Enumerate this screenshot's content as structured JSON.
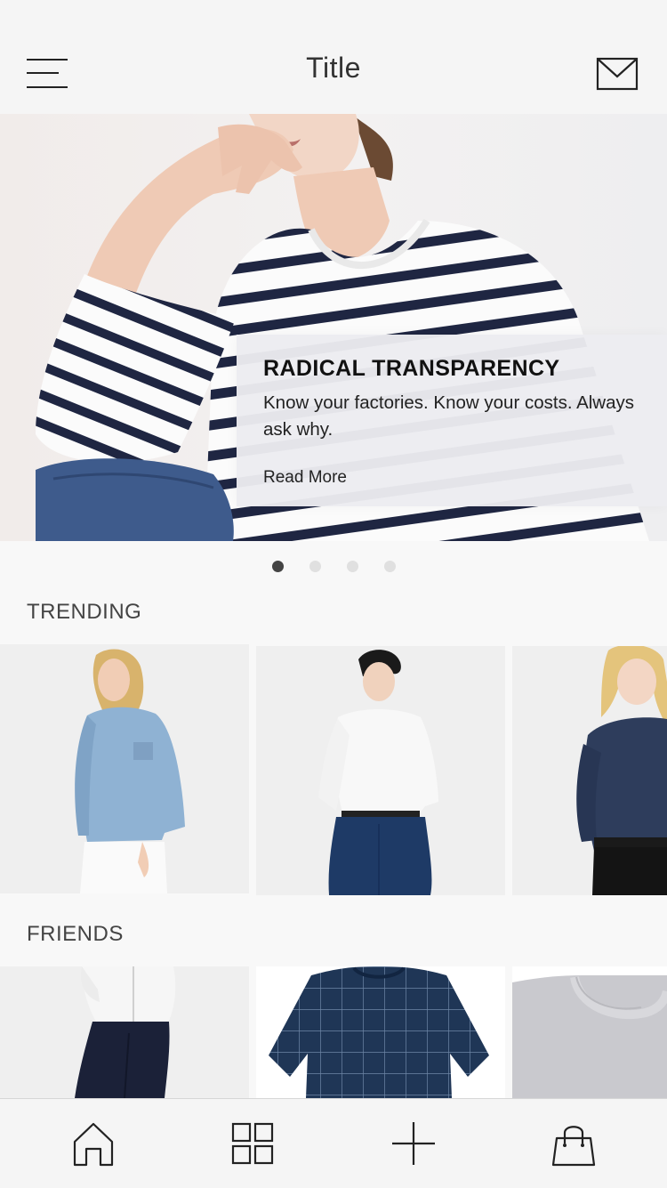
{
  "header": {
    "title": "Title",
    "menu_icon": "hamburger-menu-icon",
    "mail_icon": "envelope-icon"
  },
  "hero": {
    "heading": "RADICAL TRANSPARENCY",
    "body": "Know your factories. Know your costs. Always ask why.",
    "link_label": "Read More",
    "pages": 4,
    "active_page": 1
  },
  "sections": {
    "trending": {
      "label": "TRENDING",
      "items": [
        "chambray-denim-shirt",
        "white-oxford-shirt",
        "indigo-denim-shirt"
      ]
    },
    "friends": {
      "label": "FRIENDS",
      "items": [
        "white-zip-hoodie",
        "navy-grid-check-top",
        "grey-crew-tee"
      ]
    }
  },
  "tabbar": {
    "items": [
      {
        "name": "home",
        "icon": "home-icon"
      },
      {
        "name": "browse",
        "icon": "grid-icon"
      },
      {
        "name": "add",
        "icon": "plus-icon"
      },
      {
        "name": "bag",
        "icon": "shopping-bag-icon"
      }
    ]
  },
  "colors": {
    "background": "#f8f8f8",
    "text": "#1d1d1f",
    "active_dot": "#444444",
    "inactive_dot": "#e0e0e0"
  }
}
